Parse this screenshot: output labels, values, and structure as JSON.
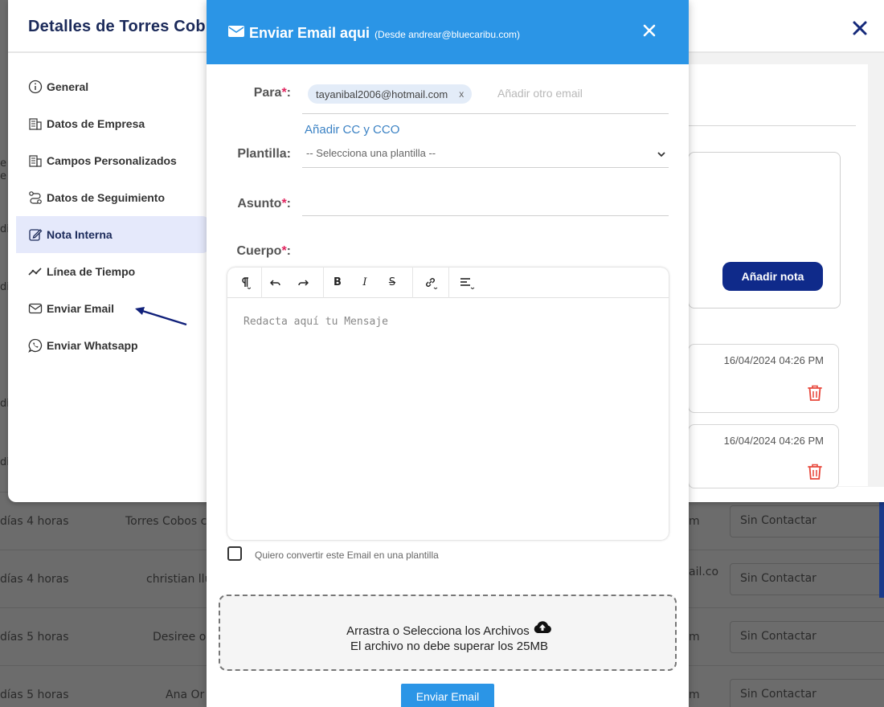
{
  "background": {
    "rows": [
      {
        "elapsed": "días 4 horas",
        "name": "Torres Cobos c",
        "email_fragment": "m",
        "status": "Sin Contactar"
      },
      {
        "elapsed": "días 4 horas",
        "name": "christian llu",
        "email_fragment": "ail.co",
        "status": "Sin Contactar"
      },
      {
        "elapsed": "días 5 horas",
        "name": "Desiree ol",
        "email_fragment": "m",
        "status": "Sin Contactar"
      },
      {
        "elapsed": "días 5 horas",
        "name": "Ana Or",
        "email_fragment": "m",
        "status": "Sin Contactar"
      }
    ],
    "left_edge": [
      "e",
      "e",
      "di",
      "di",
      "di",
      "di"
    ]
  },
  "details": {
    "title": "Detalles de Torres Cob",
    "nav": [
      {
        "label": "General",
        "icon": "info-icon"
      },
      {
        "label": "Datos de Empresa",
        "icon": "building-icon"
      },
      {
        "label": "Campos Personalizados",
        "icon": "building-icon"
      },
      {
        "label": "Datos de Seguimiento",
        "icon": "route-icon"
      },
      {
        "label": "Nota Interna",
        "icon": "edit-icon",
        "active": true
      },
      {
        "label": "Línea de Tiempo",
        "icon": "timeline-icon"
      },
      {
        "label": "Enviar Email",
        "icon": "mail-icon"
      },
      {
        "label": "Enviar Whatsapp",
        "icon": "whatsapp-icon"
      }
    ],
    "add_note_label": "Añadir nota",
    "notes": [
      {
        "date": "16/04/2024 04:26 PM"
      },
      {
        "date": "16/04/2024 04:26 PM"
      }
    ]
  },
  "email_modal": {
    "title": "Enviar Email aqui",
    "subtitle": "(Desde andrear@bluecaribu.com)",
    "to_label": "Para",
    "to_chips": [
      "tayanibal2006@hotmail.com"
    ],
    "chip_remove": "x",
    "to_placeholder": "Añadir otro email",
    "cc_link": "Añadir CC y CCO",
    "template_label": "Plantilla:",
    "template_value": "-- Selecciona una plantilla --",
    "subject_label": "Asunto",
    "body_label": "Cuerpo",
    "required_mark": "*",
    "colon": ":",
    "editor_placeholder": "Redacta aquí tu Mensaje",
    "toolbar": [
      "paragraph-icon",
      "undo-icon",
      "redo-icon",
      "bold-icon",
      "italic-icon",
      "strikethrough-icon",
      "link-icon",
      "align-icon"
    ],
    "save_template_label": "Quiero convertir este Email en una plantilla",
    "dropzone_line1": "Arrastra o Selecciona los Archivos",
    "dropzone_line2": "El archivo no debe superar los 25MB",
    "send_label": "Enviar Email"
  },
  "colors": {
    "header_blue": "#2b95e6",
    "navy": "#0f2a8a",
    "required_red": "#e0245e",
    "trash_red": "#e8473b"
  }
}
